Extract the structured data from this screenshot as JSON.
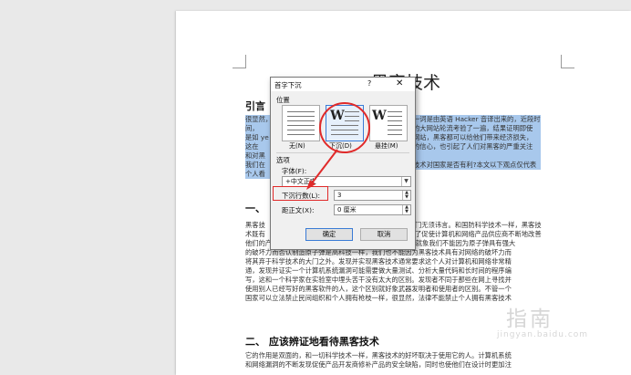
{
  "document": {
    "title": "黑客技术",
    "section1": "引言",
    "para1": [
      "很显然，",
      "间，",
      "是如 ye",
      "这在",
      "和对黑",
      "我们在",
      "个人看"
    ],
    "para1_right": [
      "一词是由英语 Hacker 音译出来的，近段时",
      "的大网站轮流考验了一遍，结果证明即使",
      "网站，黑客都可以给他们带来经济损失，",
      "的信心，也引起了人们对黑客的严重关注",
      "",
      "技术对国家是否有利?本文以下观点仅代表",
      ""
    ],
    "section2_partial": "一、",
    "para2": [
      "黑客技",
      "术既有",
      "他们的产品，对整个 internet 的发展一直起着推动作用，就象我们不能因为原子弹具有强大",
      "的破坏力而否认制造原子弹是高科技一样，我们也不能因为黑客技术具有对网络的破坏力而",
      "将其弃于科学技术的大门之外。发现并实现黑客技术通常要求这个人对计算机和网络非常精",
      "通，发现并证实一个计算机系统漏洞可能需要做大量测试、分析大量代码和长时间的程序编",
      "写，这和一个科学家在实验室中埋头苦干没有太大的区别。发现者不同于那些在网上寻找并",
      "使用别人已经写好的黑客软件的人，这个区别就好象武器发明者和使用者的区别。不管一个",
      "国家可以立法禁止民间组织和个人拥有枪枝一样，很显然，法律不能禁止个人拥有黑客技术"
    ],
    "para2_right": [
      "门无须讳言。和国防科学技术一样，黑客技",
      "了促使计算机和网络产品供应商不断地改善"
    ],
    "section2": "二、 应该辨证地看待黑客技术",
    "para3": [
      "它的作用是双面的，和一切科学技术一样，黑客技术的好坏取决于使用它的人。计算机系统",
      "和网络漏洞的不断发现促使产品开发商修补产品的安全缺陷，同时也使他们在设计时更加注"
    ]
  },
  "watermark": {
    "text": "指南",
    "sub": "jingyan.baidu.com"
  },
  "dialog": {
    "title": "首字下沉",
    "help_label": "?",
    "close_label": "✕",
    "position_group": "位置",
    "options": [
      {
        "label": "无(N)",
        "selected": false
      },
      {
        "label": "下沉(D)",
        "selected": true
      },
      {
        "label": "悬挂(M)",
        "selected": false
      }
    ],
    "options_group": "选项",
    "font_label": "字体(F):",
    "font_value": "+中文正文",
    "lines_label": "下沉行数(L):",
    "lines_value": "3",
    "distance_label": "距正文(X):",
    "distance_value": "0 厘米",
    "ok_label": "确定",
    "cancel_label": "取消"
  },
  "annotation_color": "#e02a2a",
  "selection_color": "#a8c8ec"
}
